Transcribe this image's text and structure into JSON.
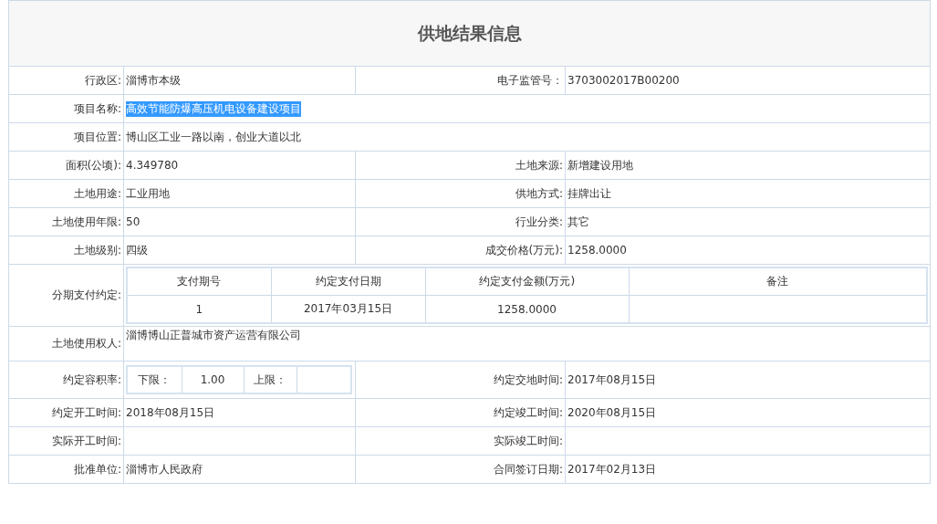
{
  "title": "供地结果信息",
  "rows": [
    {
      "kind": "pair",
      "fields": [
        {
          "label": "行政区:",
          "value": "淄博市本级",
          "selected": false
        },
        {
          "label": "电子监管号：",
          "value": "3703002017B00200",
          "selected": false
        }
      ]
    },
    {
      "kind": "wide",
      "fields": [
        {
          "label": "项目名称:",
          "value": "高效节能防爆高压机电设备建设项目",
          "selected": true
        }
      ]
    },
    {
      "kind": "wide",
      "fields": [
        {
          "label": "项目位置:",
          "value": "博山区工业一路以南，创业大道以北",
          "selected": false
        }
      ]
    },
    {
      "kind": "pair",
      "fields": [
        {
          "label": "面积(公顷):",
          "value": "4.349780",
          "selected": false
        },
        {
          "label": "土地来源:",
          "value": "新增建设用地",
          "selected": false
        }
      ]
    },
    {
      "kind": "pair",
      "fields": [
        {
          "label": "土地用途:",
          "value": "工业用地",
          "selected": false
        },
        {
          "label": "供地方式:",
          "value": "挂牌出让",
          "selected": false
        }
      ]
    },
    {
      "kind": "pair",
      "fields": [
        {
          "label": "土地使用年限:",
          "value": "50",
          "selected": false
        },
        {
          "label": "行业分类:",
          "value": "其它",
          "selected": false
        }
      ]
    },
    {
      "kind": "pair",
      "fields": [
        {
          "label": "土地级别:",
          "value": "四级",
          "selected": false
        },
        {
          "label": "成交价格(万元):",
          "value": "1258.0000",
          "selected": false
        }
      ]
    },
    {
      "kind": "payments",
      "label": "分期支付约定:",
      "columns": [
        "支付期号",
        "约定支付日期",
        "约定支付金额(万元)",
        "备注"
      ],
      "items": [
        [
          "1",
          "2017年03月15日",
          "1258.0000"
        ]
      ]
    },
    {
      "kind": "tall",
      "fields": [
        {
          "label": "土地使用权人:",
          "value": "淄博博山正普城市资产运营有限公司",
          "selected": false
        }
      ]
    },
    {
      "kind": "ratio",
      "label": "约定容积率:",
      "lower_label": "下限：",
      "lower": "1.00",
      "upper_label": "上限：",
      "fields": [
        {
          "label": "约定交地时间:",
          "value": "2017年08月15日",
          "selected": false
        }
      ]
    },
    {
      "kind": "pair",
      "fields": [
        {
          "label": "约定开工时间:",
          "value": "2018年08月15日",
          "selected": false
        },
        {
          "label": "约定竣工时间:",
          "value": "2020年08月15日",
          "selected": false
        }
      ]
    },
    {
      "kind": "pair",
      "fields": [
        {
          "label": "实际开工时间:",
          "selected": false
        },
        {
          "label": "实际竣工时间:",
          "selected": false
        }
      ]
    },
    {
      "kind": "pair",
      "fields": [
        {
          "label": "批准单位:",
          "value": "淄博市人民政府",
          "selected": false
        },
        {
          "label": "合同签订日期:",
          "value": "2017年02月13日",
          "selected": false
        }
      ]
    }
  ]
}
